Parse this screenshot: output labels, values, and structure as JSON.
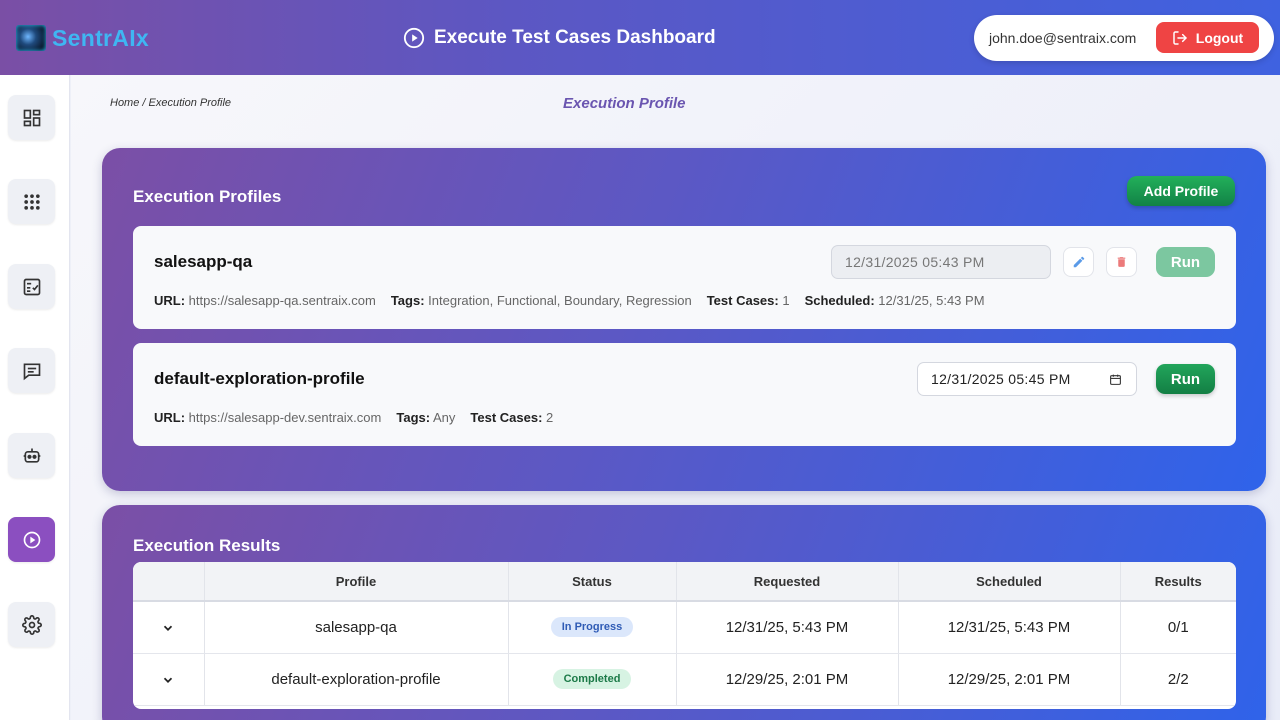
{
  "header": {
    "brand": "SentrAIx",
    "title": "Execute Test Cases Dashboard",
    "user_email": "john.doe@sentraix.com",
    "logout_label": "Logout"
  },
  "sidebar": {
    "items": [
      {
        "name": "dashboard",
        "icon": "dashboard-icon"
      },
      {
        "name": "apps",
        "icon": "grid-dots-icon"
      },
      {
        "name": "test-cases",
        "icon": "checklist-icon"
      },
      {
        "name": "chat",
        "icon": "chat-icon"
      },
      {
        "name": "agent",
        "icon": "robot-icon"
      },
      {
        "name": "execute",
        "icon": "play-circle-icon",
        "active": true
      },
      {
        "name": "settings",
        "icon": "gear-icon"
      }
    ]
  },
  "breadcrumb": "Home / Execution Profile",
  "page_title": "Execution Profile",
  "profiles_panel": {
    "title": "Execution Profiles",
    "add_label": "Add Profile",
    "profiles": [
      {
        "name": "salesapp-qa",
        "datetime": "12/31/2025 05:43 PM",
        "run_label": "Run",
        "url_label": "URL:",
        "url": "https://salesapp-qa.sentraix.com",
        "tags_label": "Tags:",
        "tags": "Integration, Functional, Boundary, Regression",
        "tc_label": "Test Cases:",
        "test_cases": "1",
        "sched_label": "Scheduled:",
        "scheduled": "12/31/25, 5:43 PM"
      },
      {
        "name": "default-exploration-profile",
        "datetime": "12/31/2025 05:45 PM",
        "run_label": "Run",
        "url_label": "URL:",
        "url": "https://salesapp-dev.sentraix.com",
        "tags_label": "Tags:",
        "tags": "Any",
        "tc_label": "Test Cases:",
        "test_cases": "2"
      }
    ]
  },
  "results_panel": {
    "title": "Execution Results",
    "columns": [
      "",
      "Profile",
      "Status",
      "Requested",
      "Scheduled",
      "Results"
    ],
    "rows": [
      {
        "profile": "salesapp-qa",
        "status": "In Progress",
        "requested": "12/31/25, 5:43 PM",
        "scheduled": "12/31/25, 5:43 PM",
        "results": "0/1"
      },
      {
        "profile": "default-exploration-profile",
        "status": "Completed",
        "requested": "12/29/25, 2:01 PM",
        "scheduled": "12/29/25, 2:01 PM",
        "results": "2/2"
      }
    ]
  },
  "colors": {
    "accent_purple": "#8b4fc0",
    "run_green": "#1b9450",
    "logout_red": "#ef4444",
    "brand_blue": "#3fb6f2"
  }
}
